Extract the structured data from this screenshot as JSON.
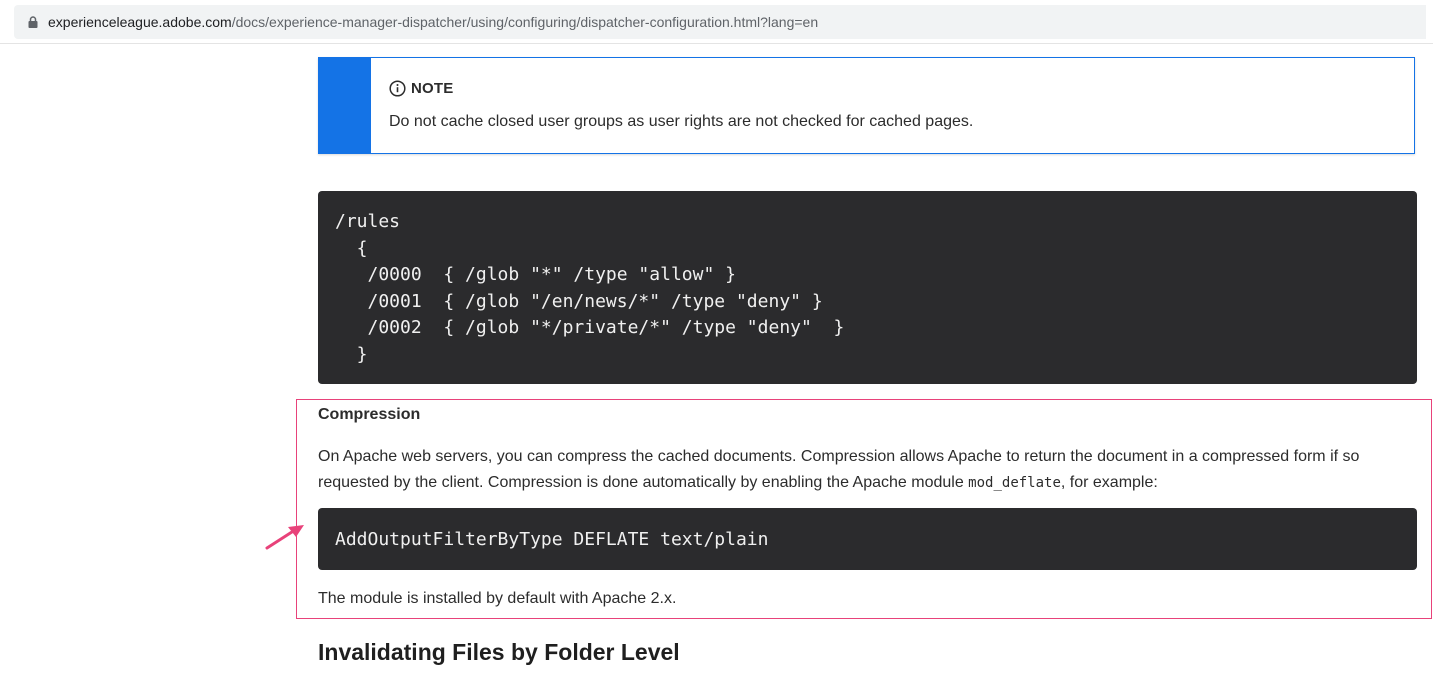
{
  "browser": {
    "url_host": "experienceleague.adobe.com",
    "url_path": "/docs/experience-manager-dispatcher/using/configuring/dispatcher-configuration.html?lang=en"
  },
  "note": {
    "title": "NOTE",
    "text": "Do not cache closed user groups as user rights are not checked for cached pages."
  },
  "rules_code": "/rules\n  {\n   /0000  { /glob \"*\" /type \"allow\" }\n   /0001  { /glob \"/en/news/*\" /type \"deny\" }\n   /0002  { /glob \"*/private/*\" /type \"deny\"  }\n  }",
  "compression": {
    "heading": "Compression",
    "para_before_code": "On Apache web servers, you can compress the cached documents. Compression allows Apache to return the document in a compressed form if so requested by the client. Compression is done automatically by enabling the Apache module ",
    "inline_code": "mod_deflate",
    "para_after_code": ", for example:",
    "code": "AddOutputFilterByType DEFLATE text/plain",
    "note_after": "The module is installed by default with Apache 2.x."
  },
  "next_heading": "Invalidating Files by Folder Level",
  "colors": {
    "note_accent": "#1473e6",
    "highlight_border": "#e8427a",
    "arrow": "#e8427a",
    "code_bg": "#2b2b2d"
  },
  "icons": {
    "lock": "lock-icon",
    "info": "info-icon",
    "arrow": "annotation-arrow-icon"
  }
}
